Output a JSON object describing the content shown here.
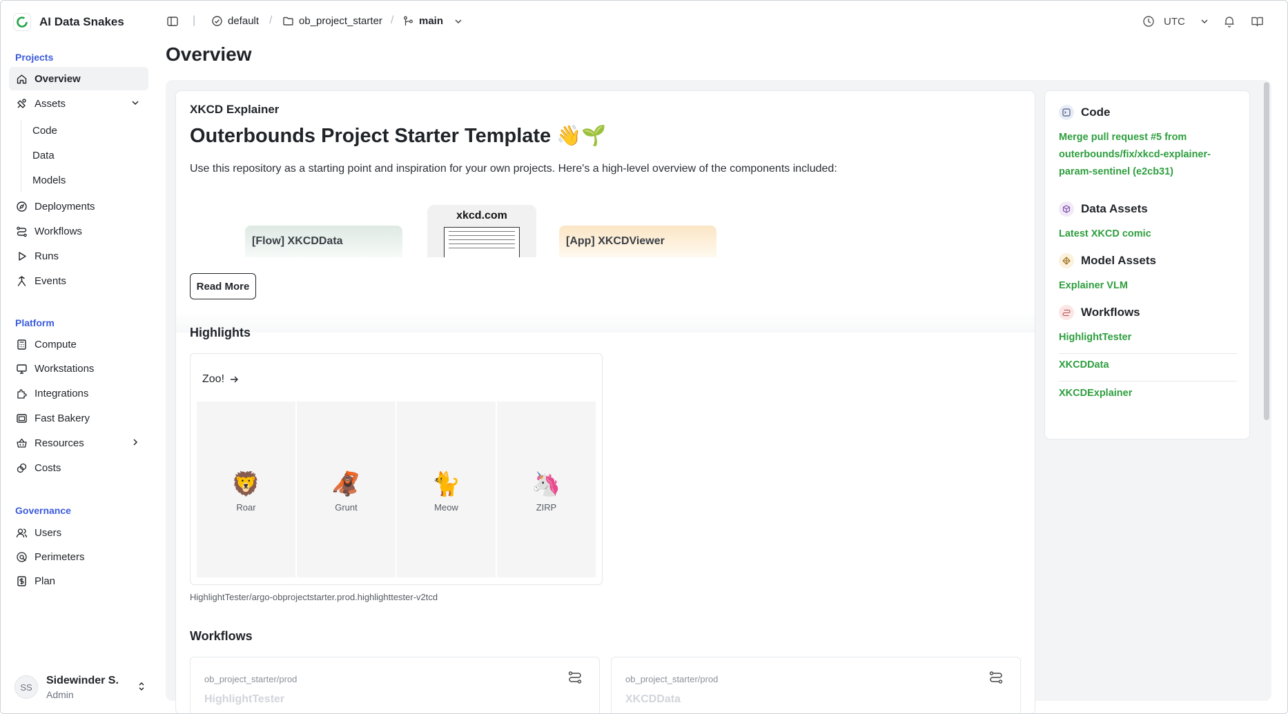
{
  "app": {
    "name": "AI Data Snakes"
  },
  "topbar": {
    "workspace": "default",
    "project": "ob_project_starter",
    "branch": "main",
    "timezone": "UTC"
  },
  "sidebar": {
    "projects_title": "Projects",
    "overview": "Overview",
    "assets": "Assets",
    "assets_sub": [
      "Code",
      "Data",
      "Models"
    ],
    "deployments": "Deployments",
    "workflows": "Workflows",
    "runs": "Runs",
    "events": "Events",
    "platform_title": "Platform",
    "compute": "Compute",
    "workstations": "Workstations",
    "integrations": "Integrations",
    "fast_bakery": "Fast Bakery",
    "resources": "Resources",
    "costs": "Costs",
    "governance_title": "Governance",
    "users": "Users",
    "perimeters": "Perimeters",
    "plan": "Plan",
    "user": {
      "initials": "SS",
      "name": "Sidewinder S.",
      "role": "Admin"
    }
  },
  "page": {
    "title": "Overview"
  },
  "readme": {
    "eyebrow": "XKCD Explainer",
    "title": "Outerbounds Project Starter Template 👋🌱",
    "description": "Use this repository as a starting point and inspiration for your own projects. Here's a high-level overview of the components included:",
    "diagram": {
      "flow_label": "[Flow] XKCDData",
      "site_label": "xkcd.com",
      "app_label": "[App] XKCDViewer"
    },
    "read_more": "Read More"
  },
  "highlights": {
    "title": "Highlights",
    "card_title": "Zoo!",
    "animals": [
      {
        "emoji": "🦁",
        "label": "Roar"
      },
      {
        "emoji": "🦧",
        "label": "Grunt"
      },
      {
        "emoji": "🐈",
        "label": "Meow"
      },
      {
        "emoji": "🦄",
        "label": "ZIRP"
      }
    ],
    "source_path": "HighlightTester/argo-obprojectstarter.prod.highlighttester-v2tcd"
  },
  "workflows_section": {
    "title": "Workflows",
    "cards": [
      {
        "path": "ob_project_starter/prod",
        "name": "HighlightTester"
      },
      {
        "path": "ob_project_starter/prod",
        "name": "XKCDData"
      }
    ]
  },
  "side_panel": {
    "code_title": "Code",
    "code_commit": [
      "Merge pull request #5 from",
      "outerbounds/fix/xkcd-explainer-",
      "param-sentinel (e2cb31)"
    ],
    "data_assets_title": "Data Assets",
    "data_asset": "Latest XKCD comic",
    "model_assets_title": "Model Assets",
    "model_asset": "Explainer VLM",
    "workflows_title": "Workflows",
    "workflows": [
      "HighlightTester",
      "XKCDData",
      "XKCDExplainer"
    ]
  },
  "colors": {
    "accent_blue": "#3b5bdb",
    "link_green": "#2e9e3e",
    "panel_bg": "#f3f4f6"
  }
}
